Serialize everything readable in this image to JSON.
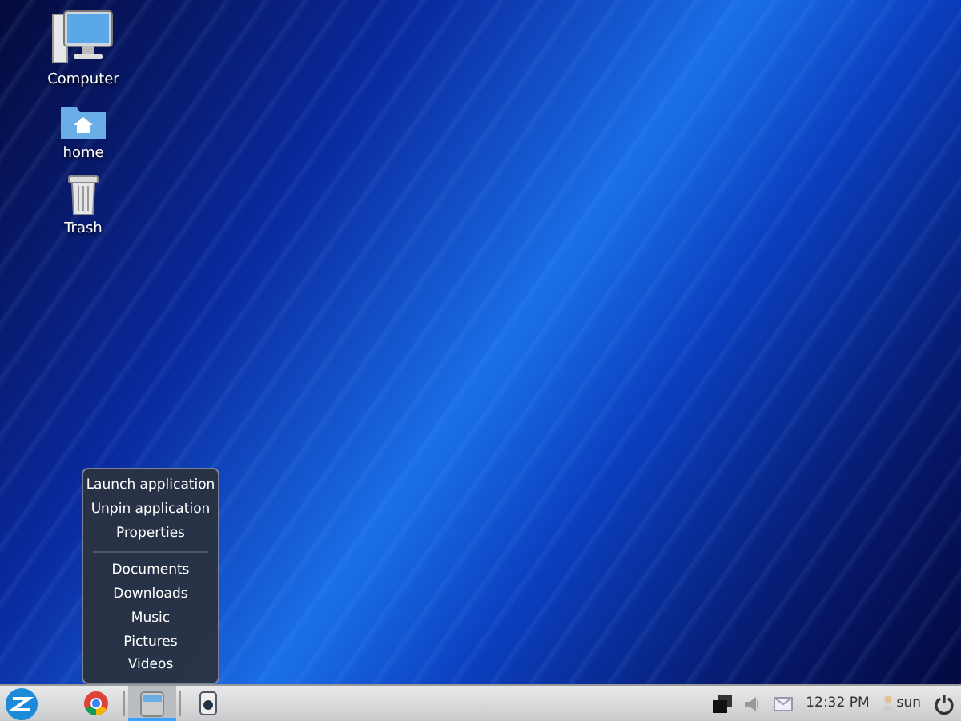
{
  "desktop_icons": [
    {
      "kind": "computer",
      "label": "Computer"
    },
    {
      "kind": "folder",
      "label": "home"
    },
    {
      "kind": "trash",
      "label": "Trash"
    }
  ],
  "context_menu": {
    "actions": [
      "Launch application",
      "Unpin application",
      "Properties"
    ],
    "places": [
      "Documents",
      "Downloads",
      "Music",
      "Pictures",
      "Videos"
    ]
  },
  "taskbar": {
    "launchers": [
      {
        "kind": "browser",
        "selected": false
      },
      {
        "kind": "files",
        "selected": true
      },
      {
        "kind": "scanner",
        "selected": false
      }
    ],
    "tray": {
      "time": "12:32 PM",
      "user": "sun"
    }
  }
}
